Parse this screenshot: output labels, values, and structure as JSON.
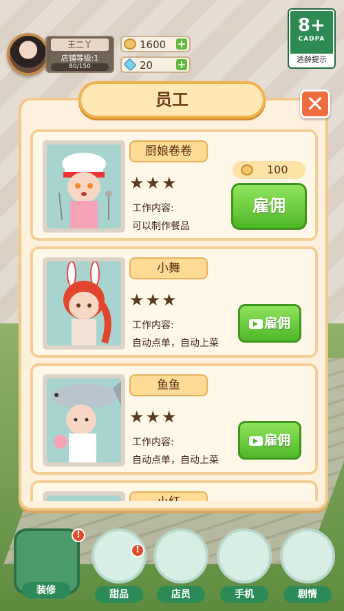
{
  "player": {
    "name": "王二丫",
    "shop_level": "店铺等级:1",
    "exp": "80/150"
  },
  "resources": {
    "coins": "1600",
    "diamonds": "20"
  },
  "rating": {
    "age": "8+",
    "org": "CADPA",
    "tip": "适龄提示"
  },
  "panel": {
    "title": "员工"
  },
  "employees": [
    {
      "name": "厨娘卷卷",
      "stars": "★★★",
      "work_label": "工作内容:",
      "work_desc": "可以制作餐品",
      "price": "100",
      "hire_label": "雇佣"
    },
    {
      "name": "小舞",
      "stars": "★★★",
      "work_label": "工作内容:",
      "work_desc": "自动点单，自动上菜",
      "hire_label": "雇佣"
    },
    {
      "name": "鱼鱼",
      "stars": "★★★",
      "work_label": "工作内容:",
      "work_desc": "自动点单，自动上菜",
      "hire_label": "雇佣"
    },
    {
      "name": "小红"
    }
  ],
  "nav": [
    {
      "label": "装修",
      "badge": "!"
    },
    {
      "label": "甜品",
      "badge": "!"
    },
    {
      "label": "店员"
    },
    {
      "label": "手机"
    },
    {
      "label": "剧情"
    }
  ],
  "colors": {
    "accent_green": "#4fb828",
    "panel_border": "#f0c98a",
    "close_red": "#ef6d3f"
  }
}
